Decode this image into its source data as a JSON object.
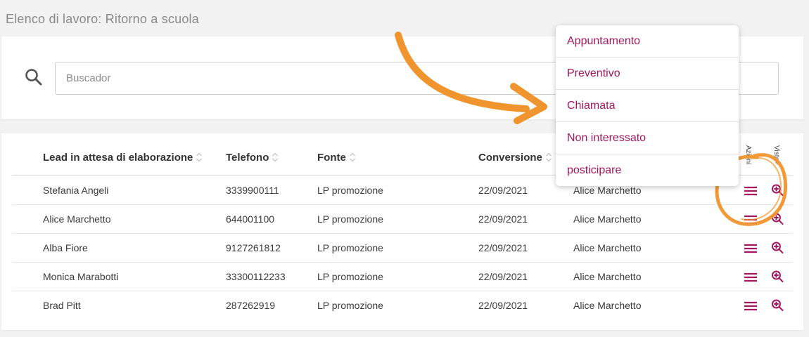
{
  "page": {
    "title": "Elenco di lavoro: Ritorno a scuola"
  },
  "search": {
    "placeholder": "Buscador",
    "value": ""
  },
  "table": {
    "columns": [
      {
        "label": "Lead in attesa di elaborazione",
        "sortable": true
      },
      {
        "label": "Telefono",
        "sortable": true
      },
      {
        "label": "Fonte",
        "sortable": true
      },
      {
        "label": "Conversione",
        "sortable": true
      }
    ],
    "action_columns": {
      "actions": "Azioni",
      "detail": "Vista+"
    },
    "rows": [
      {
        "name": "Stefania Angeli",
        "phone": "3339900111",
        "source": "LP promozione",
        "date": "22/09/2021",
        "agent": "Alice Marchetto"
      },
      {
        "name": "Alice Marchetto",
        "phone": "644001100",
        "source": "LP promozione",
        "date": "22/09/2021",
        "agent": "Alice Marchetto"
      },
      {
        "name": "Alba Fiore",
        "phone": "9127261812",
        "source": "LP promozione",
        "date": "22/09/2021",
        "agent": "Alice Marchetto"
      },
      {
        "name": "Monica Marabotti",
        "phone": "33300112233",
        "source": "LP promozione",
        "date": "22/09/2021",
        "agent": "Alice Marchetto"
      },
      {
        "name": "Brad Pitt",
        "phone": "287262919",
        "source": "LP promozione",
        "date": "22/09/2021",
        "agent": "Alice Marchetto"
      }
    ]
  },
  "dropdown": {
    "items": [
      "Appuntamento",
      "Preventivo",
      "Chiamata",
      "Non interessato",
      "posticipare"
    ]
  },
  "colors": {
    "accent": "#a3175e",
    "annotation": "#f0952e"
  }
}
